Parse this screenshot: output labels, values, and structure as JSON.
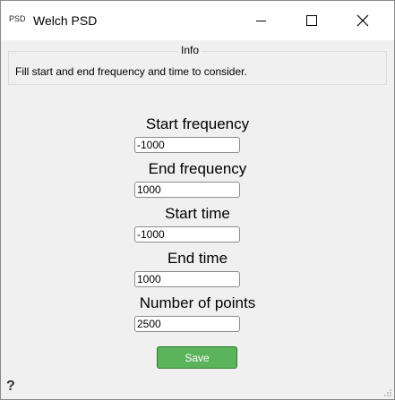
{
  "window": {
    "icon_text": "PSD",
    "title": "Welch PSD"
  },
  "info": {
    "group_title": "Info",
    "text": "Fill start and end frequency and time to consider."
  },
  "form": {
    "start_frequency_label": "Start frequency",
    "start_frequency_value": "-1000",
    "end_frequency_label": "End frequency",
    "end_frequency_value": "1000",
    "start_time_label": "Start time",
    "start_time_value": "-1000",
    "end_time_label": "End time",
    "end_time_value": "1000",
    "num_points_label": "Number of points",
    "num_points_value": "2500"
  },
  "actions": {
    "save_label": "Save"
  },
  "footer": {
    "help_glyph": "?"
  },
  "colors": {
    "save_bg": "#5bb35b",
    "window_bg": "#f0f0f0",
    "titlebar_bg": "#ffffff"
  }
}
